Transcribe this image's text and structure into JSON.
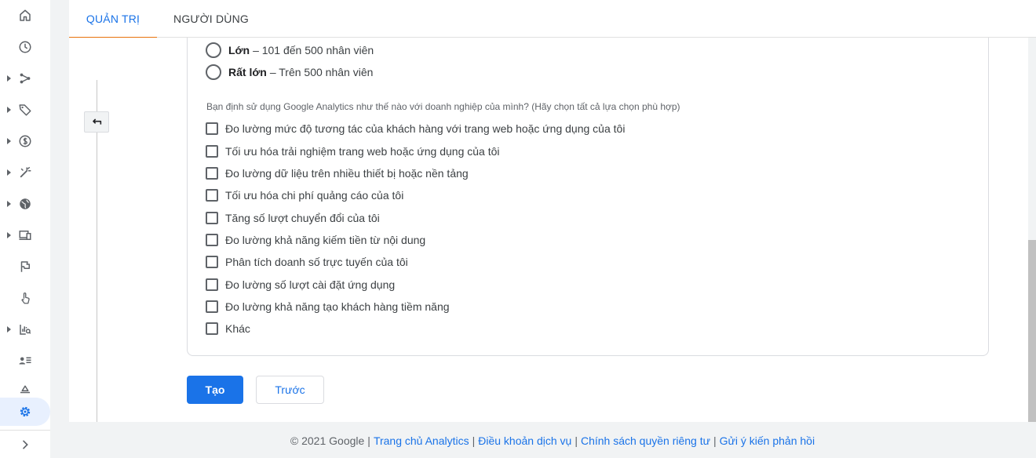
{
  "header": {
    "tabs": [
      {
        "label": "QUẢN TRỊ",
        "active": true
      },
      {
        "label": "NGƯỜI DÙNG",
        "active": false
      }
    ]
  },
  "sidebar": {
    "icons": [
      {
        "name": "home-icon",
        "expandable": false
      },
      {
        "name": "clock-icon",
        "expandable": false
      },
      {
        "name": "share-icon",
        "expandable": true
      },
      {
        "name": "tag-icon",
        "expandable": true
      },
      {
        "name": "dollar-icon",
        "expandable": true
      },
      {
        "name": "magic-wand-icon",
        "expandable": true
      },
      {
        "name": "globe-icon",
        "expandable": true
      },
      {
        "name": "devices-icon",
        "expandable": true
      },
      {
        "name": "flag-icon",
        "expandable": false
      },
      {
        "name": "touch-icon",
        "expandable": false
      },
      {
        "name": "report-icon",
        "expandable": true
      },
      {
        "name": "person-list-icon",
        "expandable": false
      },
      {
        "name": "shapes-icon",
        "expandable": false
      },
      {
        "name": "gear-icon",
        "expandable": false,
        "active": true
      }
    ],
    "expand_icon": "chevron-right-icon"
  },
  "form": {
    "size_options": [
      {
        "bold": "Lớn",
        "text": "– 101 đến 500 nhân viên"
      },
      {
        "bold": "Rất lớn",
        "text": "– Trên 500 nhân viên"
      }
    ],
    "question": "Bạn định sử dụng Google Analytics như thế nào với doanh nghiệp của mình? (Hãy chọn tất cả lựa chọn phù hợp)",
    "usage_options": [
      "Đo lường mức độ tương tác của khách hàng với trang web hoặc ứng dụng của tôi",
      "Tối ưu hóa trải nghiệm trang web hoặc ứng dụng của tôi",
      "Đo lường dữ liệu trên nhiều thiết bị hoặc nền tảng",
      "Tối ưu hóa chi phí quảng cáo của tôi",
      "Tăng số lượt chuyển đổi của tôi",
      "Đo lường khả năng kiếm tiền từ nội dung",
      "Phân tích doanh số trực tuyến của tôi",
      "Đo lường số lượt cài đặt ứng dụng",
      "Đo lường khả năng tạo khách hàng tiềm năng",
      "Khác"
    ],
    "create_label": "Tạo",
    "previous_label": "Trước"
  },
  "footer": {
    "copyright": "© 2021 Google",
    "links": [
      "Trang chủ Analytics",
      "Điều khoản dịch vụ",
      "Chính sách quyền riêng tư",
      "Gửi ý kiến phản hồi"
    ]
  },
  "colors": {
    "accent": "#1a73e8",
    "tab_indicator": "#e8710a",
    "icon": "#5f6368"
  }
}
